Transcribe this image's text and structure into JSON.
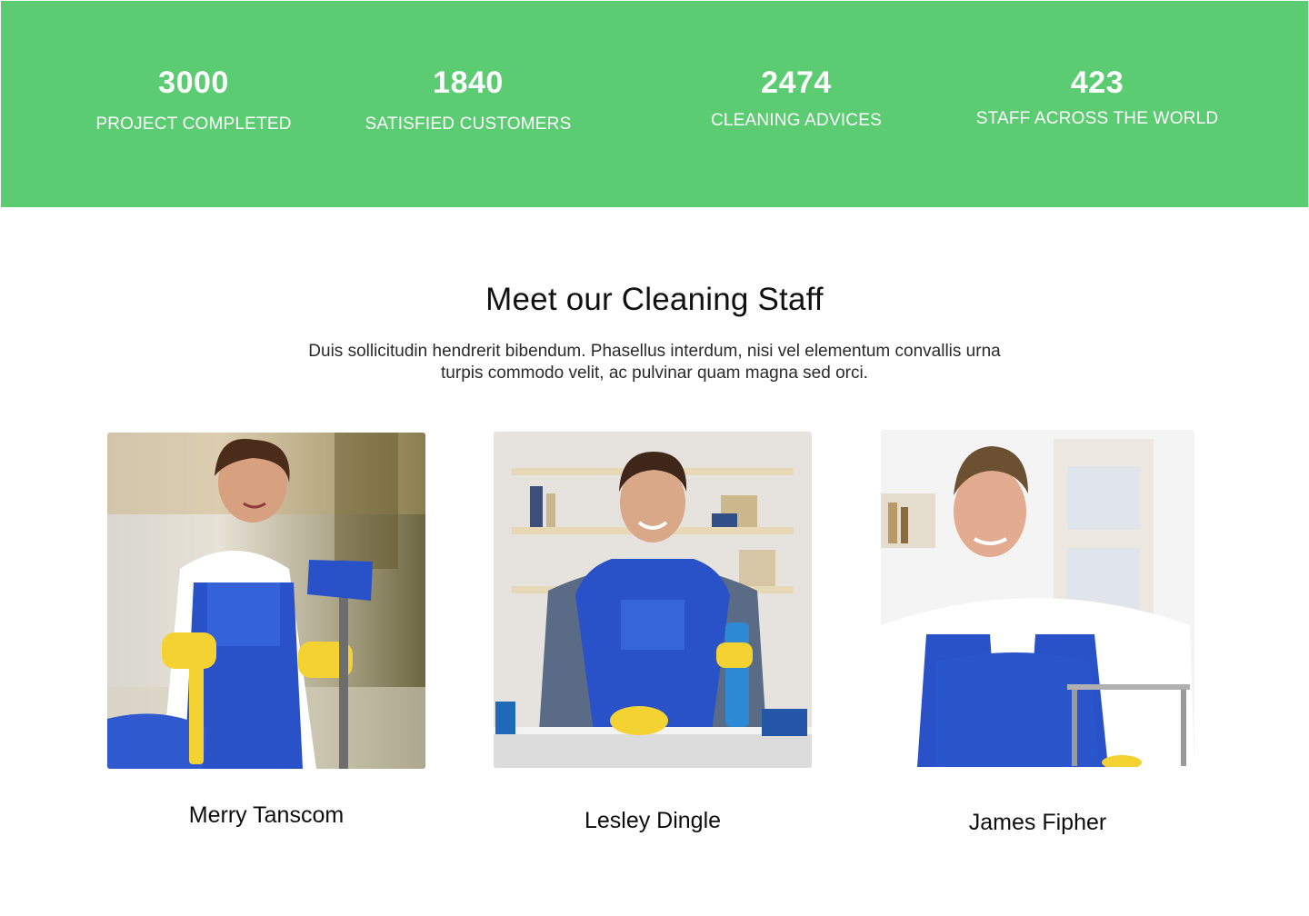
{
  "stats": [
    {
      "number": "3000",
      "label": "PROJECT COMPLETED"
    },
    {
      "number": "1840",
      "label": "SATISFIED CUSTOMERS"
    },
    {
      "number": "2474",
      "label": "CLEANING ADVICES"
    },
    {
      "number": "423",
      "label": "STAFF ACROSS THE WORLD"
    }
  ],
  "staff_section": {
    "title": "Meet our Cleaning Staff",
    "description": "Duis sollicitudin hendrerit bibendum. Phasellus interdum, nisi vel elementum convallis urna turpis commodo velit, ac pulvinar quam magna sed orci."
  },
  "staff": [
    {
      "name": "Merry Tanscom"
    },
    {
      "name": "Lesley Dingle"
    },
    {
      "name": "James Fipher"
    }
  ],
  "colors": {
    "accent": "#5bcc71",
    "uniform_blue": "#2a52c8",
    "glove_yellow": "#f4d232"
  }
}
